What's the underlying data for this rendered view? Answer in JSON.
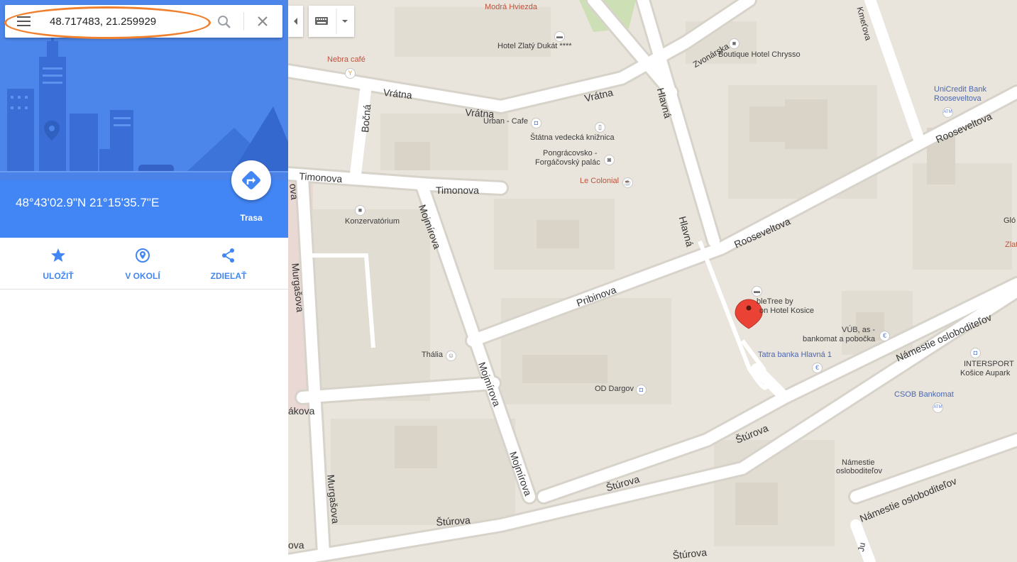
{
  "search": {
    "value": "48.717483, 21.259929"
  },
  "place": {
    "coordinates_dms": "48°43'02.9\"N 21°15'35.7\"E",
    "route_label": "Trasa"
  },
  "actions": [
    {
      "label": "ULOŽIŤ",
      "icon": "star-icon"
    },
    {
      "label": "V OKOLÍ",
      "icon": "nearby-pin-icon"
    },
    {
      "label": "ZDIEĽAŤ",
      "icon": "share-icon"
    }
  ],
  "colors": {
    "accent": "#4285f4",
    "highlight": "#f0802c",
    "map_bg": "#e9e5dc",
    "road": "#ffffff",
    "marker": "#ea4335"
  },
  "streets": {
    "vratna": "Vrátna",
    "bocna": "Bočná",
    "timonova": "Timonova",
    "murgasova": "Murgašova",
    "mojmirova": "Mojmírova",
    "pribinova": "Pribinova",
    "rooseveltova": "Rooseveltova",
    "hlavna": "Hlavná",
    "zvonarska": "Zvonárska",
    "kmetova": "Kmeťova",
    "sturova": "Štúrova",
    "namestie": "Námestie osloboditeľov",
    "akova": "ákova",
    "ova": "ova",
    "ju": "Ju"
  },
  "pois": {
    "modra_hviezda": "Modrá Hviezda",
    "zlaty_dukat": "Hotel Zlatý Dukát ****",
    "boutique": "Boutique Hotel Chrysso",
    "nebra": "Nebra café",
    "unicredit": "UniCredit Bank Rooseveltova",
    "urban_cafe": "Urban - Cafe",
    "kniznica": "Štátna vedecká knižnica",
    "palac_1": "Pongrácovsko -",
    "palac_2": "Forgáčovský palác",
    "colonial": "Le Colonial",
    "konzervatorium": "Konzervatórium",
    "doubletree_1": "bleTree by",
    "doubletree_2": "on Hotel Kosice",
    "vub_1": "VÚB, as -",
    "vub_2": "bankomat a pobočka",
    "tatra": "Tatra banka Hlavná 1",
    "intersport_1": "INTERSPORT",
    "intersport_2": "Košice Aupark",
    "csob": "CSOB Bankomat",
    "thalia": "Thália",
    "dargov": "OD Dargov",
    "namestie_1": "Námestie",
    "namestie_2": "osloboditeľov",
    "glo": "Gló",
    "zla": "Zlat",
    "atm": "ATM",
    "euro": "€"
  }
}
